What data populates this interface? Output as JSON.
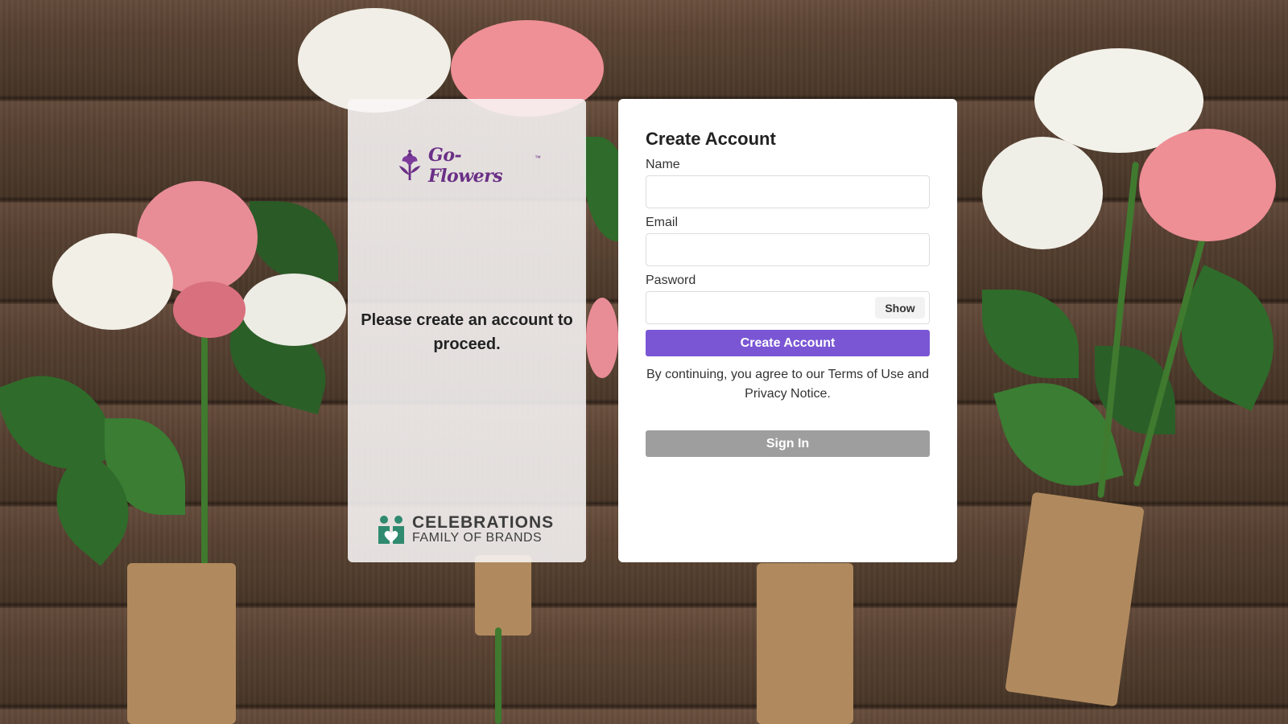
{
  "left_panel": {
    "logo_text": "Go-Flowers",
    "logo_tm": "™",
    "message": "Please create an account to proceed.",
    "brand_line1": "CELEBRATIONS",
    "brand_line2": "FAMILY OF BRANDS"
  },
  "form": {
    "title": "Create Account",
    "name_label": "Name",
    "name_value": "",
    "email_label": "Email",
    "email_value": "",
    "password_label": "Pasword",
    "password_value": "",
    "show_label": "Show",
    "create_label": "Create Account",
    "legal_text": "By continuing, you agree to our Terms of Use and Privacy Notice.",
    "signin_label": "Sign In"
  },
  "colors": {
    "accent": "#7a56d4",
    "secondary_button": "#9e9e9e",
    "logo_purple": "#6a2f86",
    "brand_green": "#2f8a6f"
  },
  "icons": {
    "logo": "tulip-icon",
    "brand": "family-heart-icon"
  }
}
